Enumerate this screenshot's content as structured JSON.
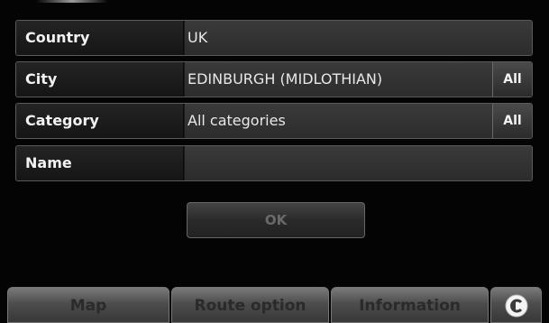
{
  "form": {
    "country": {
      "label": "Country",
      "value": "UK"
    },
    "city": {
      "label": "City",
      "value": "EDINBURGH (MIDLOTHIAN)",
      "button": "All"
    },
    "category": {
      "label": "Category",
      "value": "All categories",
      "button": "All"
    },
    "name": {
      "label": "Name",
      "value": ""
    }
  },
  "ok_button": "OK",
  "bottom_bar": {
    "map": "Map",
    "route_option": "Route option",
    "information": "Information",
    "back_icon": "back-arrow-icon"
  },
  "colors": {
    "background": "#040404",
    "field": "#333333",
    "label_panel": "#1c1c1c",
    "tab": "#555555"
  }
}
